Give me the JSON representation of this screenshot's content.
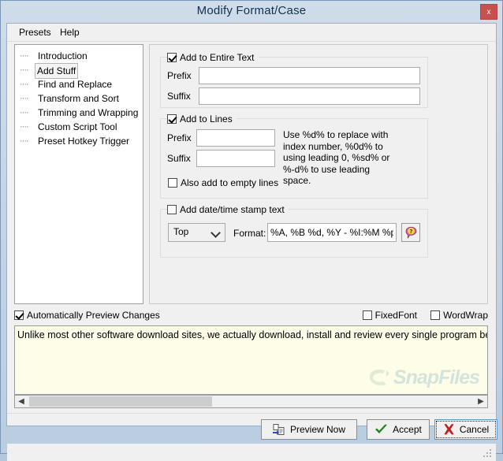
{
  "window": {
    "title": "Modify Format/Case",
    "close_label": "x"
  },
  "menu": {
    "items": [
      {
        "label": "Presets"
      },
      {
        "label": "Help"
      }
    ]
  },
  "sidebar": {
    "items": [
      {
        "label": "Introduction",
        "selected": false
      },
      {
        "label": "Add Stuff",
        "selected": true
      },
      {
        "label": "Find and Replace",
        "selected": false
      },
      {
        "label": "Transform and Sort",
        "selected": false
      },
      {
        "label": "Trimming and Wrapping",
        "selected": false
      },
      {
        "label": "Custom Script Tool",
        "selected": false
      },
      {
        "label": "Preset Hotkey Trigger",
        "selected": false
      }
    ]
  },
  "entire_text_group": {
    "title": "Add to Entire Text",
    "checked": true,
    "prefix_label": "Prefix",
    "prefix_value": "",
    "suffix_label": "Suffix",
    "suffix_value": ""
  },
  "lines_group": {
    "title": "Add to Lines",
    "checked": true,
    "prefix_label": "Prefix",
    "prefix_value": "",
    "suffix_label": "Suffix",
    "suffix_value": "",
    "hint": "Use %d% to replace with index number, %0d% to using leading 0, %sd% or %-d% to use leading space.",
    "empty_lines_label": "Also add to empty lines",
    "empty_lines_checked": false
  },
  "datestamp_group": {
    "title": "Add date/time stamp text",
    "checked": false,
    "position_value": "Top",
    "format_label": "Format:",
    "format_value": "%A, %B %d, %Y - %I:%M %p",
    "help_icon": "help-bubble-icon"
  },
  "preview_options": {
    "auto_preview_label": "Automatically Preview Changes",
    "auto_preview_checked": true,
    "fixed_font_label": "FixedFont",
    "fixed_font_checked": false,
    "word_wrap_label": "WordWrap",
    "word_wrap_checked": false
  },
  "preview": {
    "text": "Unlike most other software download sites, we actually download, install and review every single program before it is listed on the sit",
    "watermark": "SnapFiles",
    "scroll_left_icon": "chevron-left-icon",
    "scroll_right_icon": "chevron-right-icon"
  },
  "buttons": {
    "preview_now": "Preview Now",
    "preview_now_icon": "copy-to-document-icon",
    "accept": "Accept",
    "accept_icon": "green-check-icon",
    "cancel": "Cancel",
    "cancel_icon": "red-x-icon"
  },
  "colors": {
    "titlebar_top": "#cfdcea",
    "titlebar_bottom": "#bacde1",
    "close_red": "#c9504e",
    "panel_bg": "#f0f0f0",
    "preview_bg": "#fdfde8",
    "accent_focus": "#5b9bd5",
    "watermark": "#7fa8c4"
  }
}
